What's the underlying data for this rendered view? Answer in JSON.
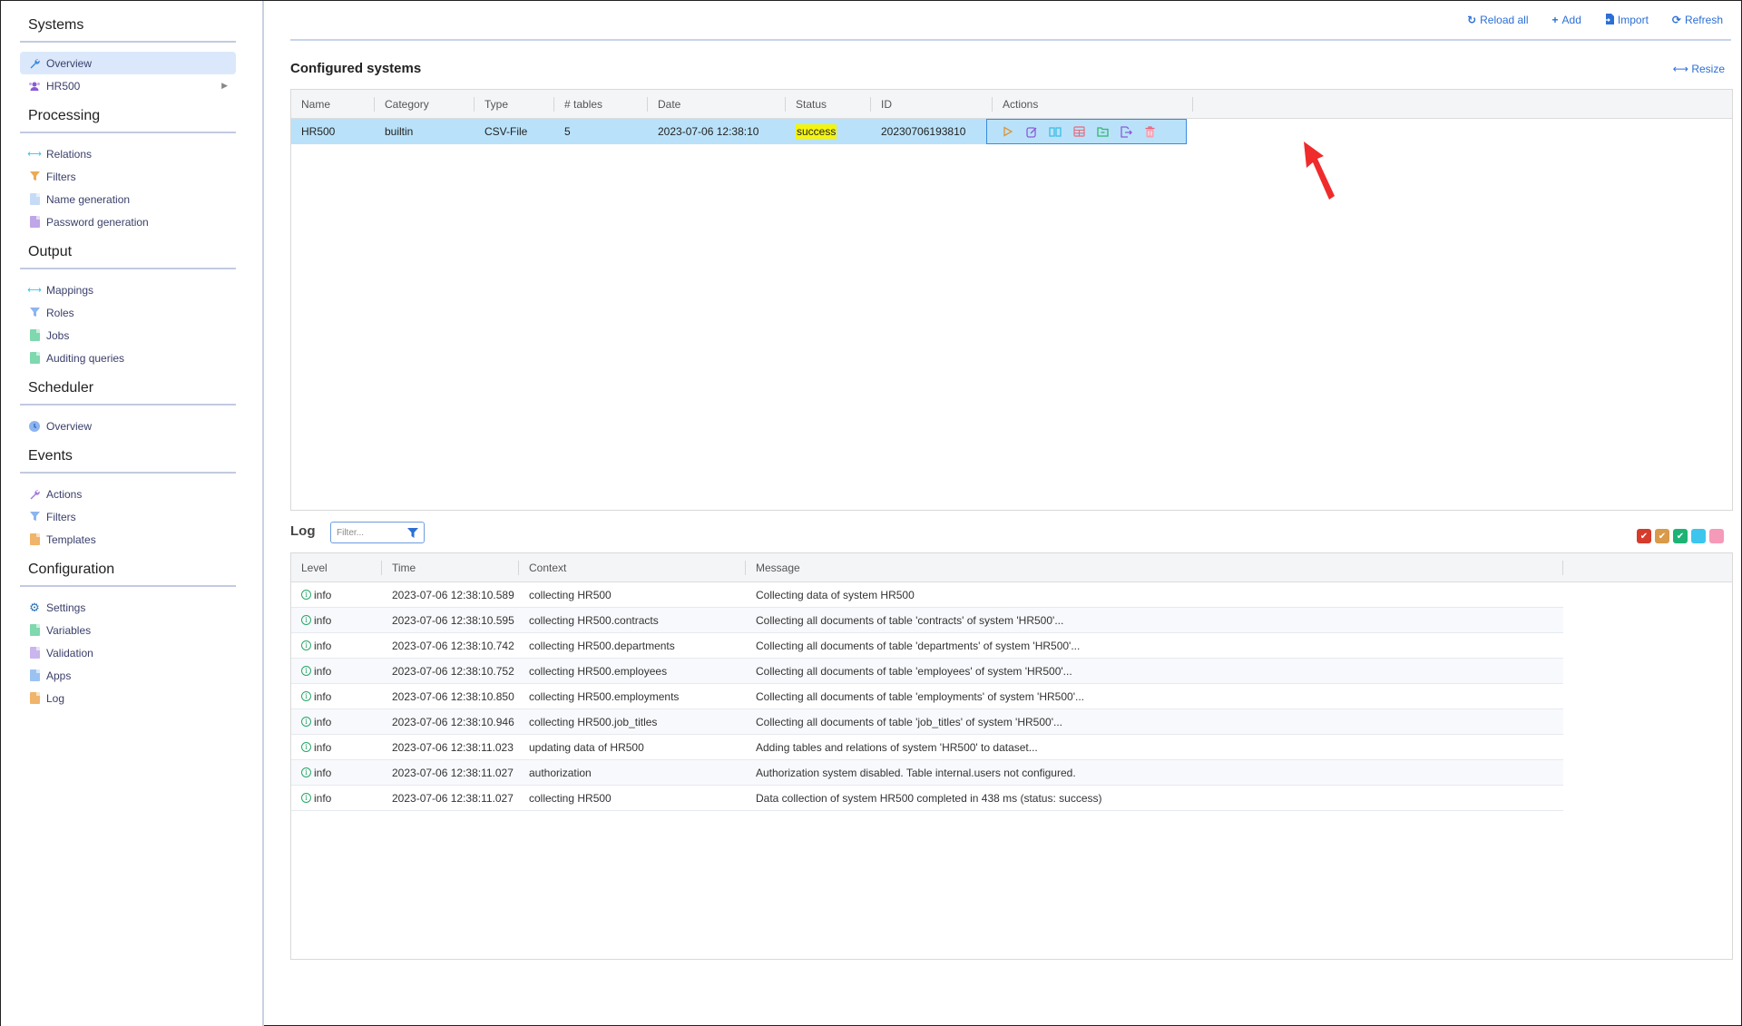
{
  "sidebar": {
    "sections": [
      {
        "title": "Systems",
        "items": [
          {
            "label": "Overview",
            "icon": "wrench-icon",
            "active": true
          },
          {
            "label": "HR500",
            "icon": "users-icon",
            "has_submenu": true
          }
        ]
      },
      {
        "title": "Processing",
        "items": [
          {
            "label": "Relations",
            "icon": "arrows-horizontal-icon"
          },
          {
            "label": "Filters",
            "icon": "filter-icon"
          },
          {
            "label": "Name generation",
            "icon": "file-edit-icon"
          },
          {
            "label": "Password generation",
            "icon": "file-edit-icon"
          }
        ]
      },
      {
        "title": "Output",
        "items": [
          {
            "label": "Mappings",
            "icon": "arrows-horizontal-icon"
          },
          {
            "label": "Roles",
            "icon": "filter-icon"
          },
          {
            "label": "Jobs",
            "icon": "file-edit-icon"
          },
          {
            "label": "Auditing queries",
            "icon": "file-icon"
          }
        ]
      },
      {
        "title": "Scheduler",
        "items": [
          {
            "label": "Overview",
            "icon": "clock-icon"
          }
        ]
      },
      {
        "title": "Events",
        "items": [
          {
            "label": "Actions",
            "icon": "wrench-icon"
          },
          {
            "label": "Filters",
            "icon": "filter-icon"
          },
          {
            "label": "Templates",
            "icon": "file-icon"
          }
        ]
      },
      {
        "title": "Configuration",
        "items": [
          {
            "label": "Settings",
            "icon": "gear-icon"
          },
          {
            "label": "Variables",
            "icon": "file-icon"
          },
          {
            "label": "Validation",
            "icon": "file-icon"
          },
          {
            "label": "Apps",
            "icon": "file-edit-icon"
          },
          {
            "label": "Log",
            "icon": "file-icon"
          }
        ]
      }
    ]
  },
  "toolbar": {
    "reload_all": "Reload all",
    "add": "Add",
    "import": "Import",
    "refresh": "Refresh"
  },
  "systems": {
    "title": "Configured systems",
    "resize_label": "Resize",
    "columns": [
      "Name",
      "Category",
      "Type",
      "# tables",
      "Date",
      "Status",
      "ID",
      "Actions"
    ],
    "rows": [
      {
        "name": "HR500",
        "category": "builtin",
        "type": "CSV-File",
        "tables": "5",
        "date": "2023-07-06 12:38:10",
        "status": "success",
        "id": "20230706193810"
      }
    ],
    "actions": [
      "run",
      "edit",
      "documentation",
      "tables",
      "folder",
      "export",
      "delete"
    ]
  },
  "log": {
    "title": "Log",
    "filter_placeholder": "Filter...",
    "columns": [
      "Level",
      "Time",
      "Context",
      "Message"
    ],
    "level_toggles": [
      {
        "level": "error",
        "color": "#d63b2b",
        "checked": true
      },
      {
        "level": "warning",
        "color": "#d99a4a",
        "checked": true
      },
      {
        "level": "info",
        "color": "#1eb374",
        "checked": true
      },
      {
        "level": "debug",
        "color": "#3cc6ee",
        "checked": false
      },
      {
        "level": "trace",
        "color": "#f59ab8",
        "checked": false
      }
    ],
    "rows": [
      {
        "level": "info",
        "time": "2023-07-06 12:38:10.589",
        "context": "collecting HR500",
        "message": "Collecting data of system HR500"
      },
      {
        "level": "info",
        "time": "2023-07-06 12:38:10.595",
        "context": "collecting HR500.contracts",
        "message": "Collecting all documents of table 'contracts' of system 'HR500'..."
      },
      {
        "level": "info",
        "time": "2023-07-06 12:38:10.742",
        "context": "collecting HR500.departments",
        "message": "Collecting all documents of table 'departments' of system 'HR500'..."
      },
      {
        "level": "info",
        "time": "2023-07-06 12:38:10.752",
        "context": "collecting HR500.employees",
        "message": "Collecting all documents of table 'employees' of system 'HR500'..."
      },
      {
        "level": "info",
        "time": "2023-07-06 12:38:10.850",
        "context": "collecting HR500.employments",
        "message": "Collecting all documents of table 'employments' of system 'HR500'..."
      },
      {
        "level": "info",
        "time": "2023-07-06 12:38:10.946",
        "context": "collecting HR500.job_titles",
        "message": "Collecting all documents of table 'job_titles' of system 'HR500'..."
      },
      {
        "level": "info",
        "time": "2023-07-06 12:38:11.023",
        "context": "updating data of HR500",
        "message": "Adding tables and relations of system 'HR500' to dataset..."
      },
      {
        "level": "info",
        "time": "2023-07-06 12:38:11.027",
        "context": "authorization",
        "message": "Authorization system disabled. Table internal.users not configured."
      },
      {
        "level": "info",
        "time": "2023-07-06 12:38:11.027",
        "context": "collecting HR500",
        "message": "Data collection of system HR500 completed in 438 ms (status: success)"
      }
    ]
  }
}
